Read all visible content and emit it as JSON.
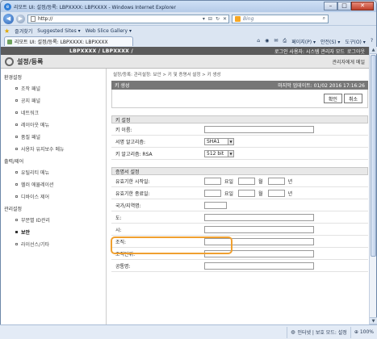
{
  "browser": {
    "window_title": "리모트 UI: 설정/등록: LBPXXXX: LBPXXXX - Windows Internet Explorer",
    "address": "http://",
    "search_placeholder": "Bing",
    "favorites": [
      "즐겨찾기",
      "Suggested Sites ▾",
      "Web Slice Gallery ▾"
    ],
    "tab_title": "리모트 UI: 설정/등록: LBPXXXX: LBPXXXX",
    "commands": [
      "페이지(P) ▾",
      "안전(S) ▾",
      "도구(O) ▾"
    ],
    "status": {
      "zone": "인터넷 | 보호 모드: 설정",
      "zoom": "100%"
    }
  },
  "app": {
    "product": "LBPXXXX / LBPXXXX /",
    "user": "로그인 사용자: 시스템 관리자 모드",
    "logout": "로그아웃",
    "page_title": "설정/등록",
    "admin_link": "관리자에게 메일"
  },
  "sidebar": {
    "groups": [
      {
        "title": "환경설정",
        "items": [
          {
            "label": "조작 패널",
            "active": false
          },
          {
            "label": "공지 패널",
            "active": false
          },
          {
            "label": "네트워크",
            "active": false
          },
          {
            "label": "레이아웃 메뉴",
            "active": false
          },
          {
            "label": "품질 패널",
            "active": false
          },
          {
            "label": "사용자 유지보수 메뉴",
            "active": false
          }
        ]
      },
      {
        "title": "출력/제어",
        "items": [
          {
            "label": "유틸리티 메뉴",
            "active": false
          },
          {
            "label": "헬러 에뮬레이션",
            "active": false
          },
          {
            "label": "디바이스 제어",
            "active": false
          }
        ]
      },
      {
        "title": "관리설정",
        "items": [
          {
            "label": "부문별 ID관리",
            "active": false
          },
          {
            "label": "보안",
            "active": true
          },
          {
            "label": "라이선스/기타",
            "active": false
          }
        ]
      }
    ]
  },
  "main": {
    "breadcrumb": "설정/등록: 관리설정: 보안 > 키 및 증명서 설정 > 키 생성",
    "panel_title": "키 생성",
    "last_updated": "마지막 업데이트: 01/02 2016 17:16:26",
    "ok_label": "확인",
    "cancel_label": "취소",
    "key_section": {
      "title": "키 설정",
      "rows": [
        {
          "label": "키 이름:",
          "kind": "text",
          "value": ""
        },
        {
          "label": "서명 알고리즘:",
          "kind": "select",
          "value": "SHA1"
        },
        {
          "label": "키 알고리즘: RSA",
          "kind": "select",
          "value": "512 bit"
        }
      ]
    },
    "cert_section": {
      "title": "증명서 설정",
      "date_units": [
        "요일",
        "월",
        "년"
      ],
      "rows": [
        {
          "label": "유효기한 시작일:",
          "kind": "date"
        },
        {
          "label": "유효기한 종료일:",
          "kind": "date"
        },
        {
          "label": "국가/지역명:",
          "kind": "short"
        },
        {
          "label": "도:",
          "kind": "text"
        },
        {
          "label": "시:",
          "kind": "text"
        },
        {
          "label": "조직:",
          "kind": "text"
        },
        {
          "label": "조직단위:",
          "kind": "text"
        },
        {
          "label": "공통명:",
          "kind": "text"
        }
      ]
    }
  }
}
